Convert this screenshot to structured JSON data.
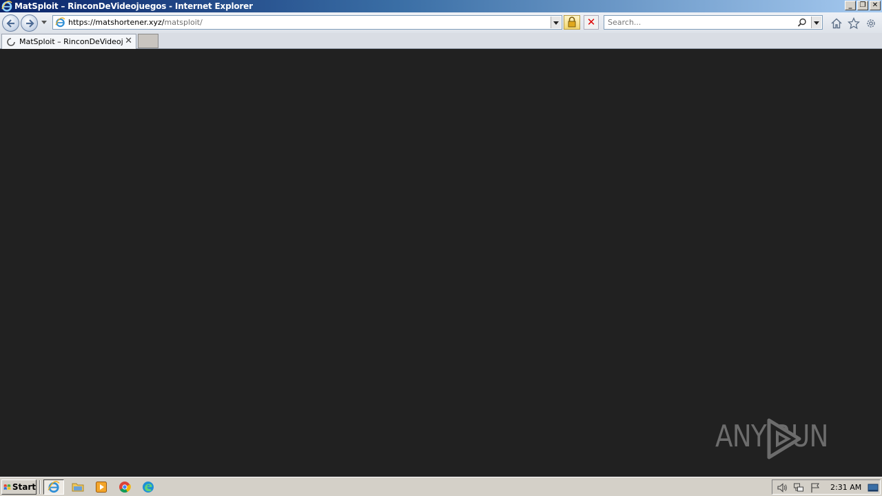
{
  "window": {
    "title": "MatSploit – RinconDeVideojuegos - Internet Explorer",
    "minimize": "_",
    "restore": "❐",
    "close": "✕"
  },
  "navbar": {
    "url_host": "https://matshortener.xyz/",
    "url_path": "matsploit/",
    "search_placeholder": "Search..."
  },
  "tabs": [
    {
      "title": "MatSploit – RinconDeVideoju..."
    }
  ],
  "tab_close": "✕",
  "watermark": "ANY RUN",
  "taskbar": {
    "start_label": "Start",
    "clock": "2:31 AM"
  },
  "colors": {
    "content_bg": "#212121",
    "watermark": "#6c6c6c"
  }
}
